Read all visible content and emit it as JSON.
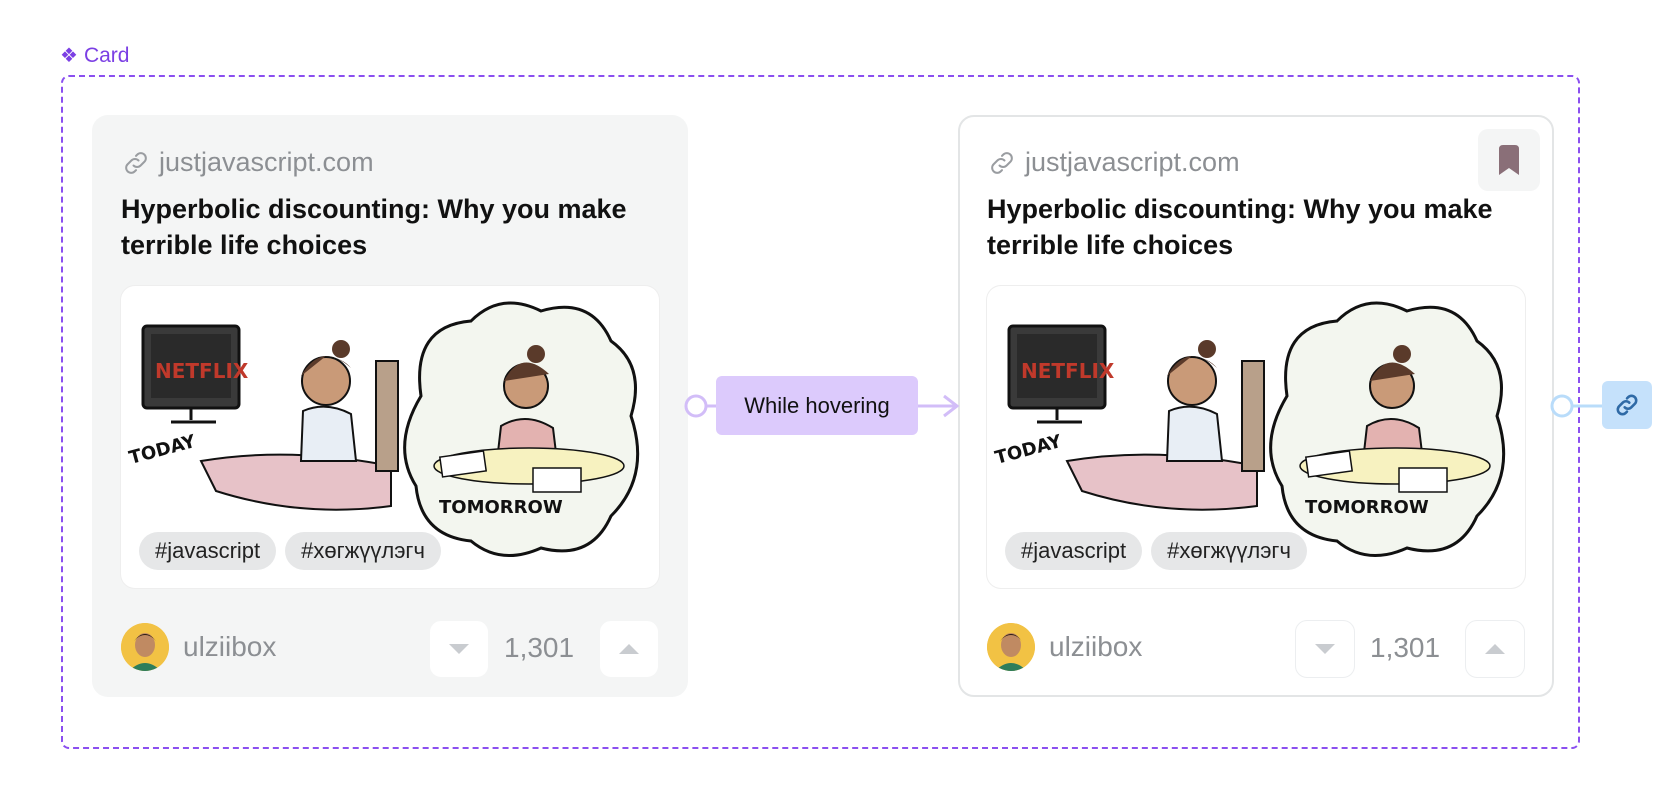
{
  "component": {
    "label": "Card",
    "icon": "component-diamond-icon"
  },
  "cards": [
    {
      "state": "default",
      "source": "justjavascript.com",
      "title": "Hyperbolic discounting: Why you make terrible life choices",
      "tags": [
        "#javascript",
        "#хөгжүүлэгч"
      ],
      "author": "ulziibox",
      "votes": "1,301"
    },
    {
      "state": "hover",
      "source": "justjavascript.com",
      "title": "Hyperbolic discounting: Why you make terrible life choices",
      "tags": [
        "#javascript",
        "#хөгжүүлэгч"
      ],
      "author": "ulziibox",
      "votes": "1,301",
      "bookmark_icon": "bookmark-icon"
    }
  ],
  "interaction": {
    "trigger": "While hovering",
    "action_icon": "link-icon"
  },
  "illustration_text": {
    "screen": "NETFLIX",
    "left": "TODAY",
    "right": "TOMORROW"
  },
  "colors": {
    "accent": "#8b4ff0",
    "pill": "#dccafc",
    "link_button": "#c5e1fb"
  }
}
